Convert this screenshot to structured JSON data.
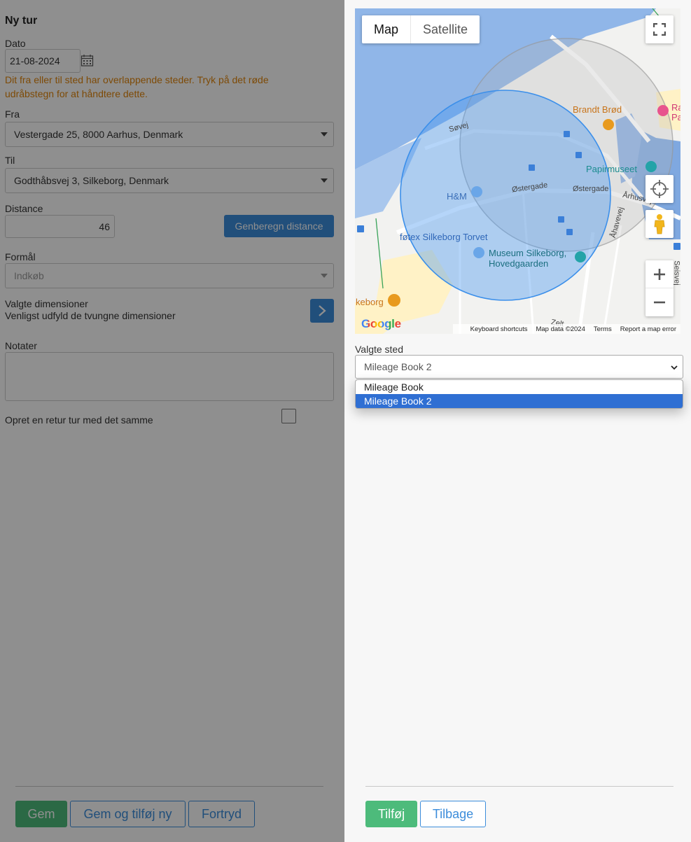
{
  "form": {
    "title": "Ny tur",
    "date_label": "Dato",
    "date_value": "21-08-2024",
    "warning": "Dit fra eller til sted har overlappende steder. Tryk på det røde udråbstegn for at håndtere dette.",
    "from_label": "Fra",
    "from_value": "Vestergade 25, 8000 Aarhus, Denmark",
    "to_label": "Til",
    "to_value": "Godthåbsvej 3, Silkeborg, Denmark",
    "distance_label": "Distance",
    "distance_value": "46",
    "recalc_button": "Genberegn distance",
    "purpose_label": "Formål",
    "purpose_value": "Indkøb",
    "dimensions_title": "Valgte dimensioner",
    "dimensions_hint": "Venligst udfyld de tvungne dimensioner",
    "notes_label": "Notater",
    "return_label": "Opret en retur tur med det samme",
    "save_button": "Gem",
    "save_add_button": "Gem og tilføj ny",
    "cancel_button": "Fortryd"
  },
  "map": {
    "type_map": "Map",
    "type_satellite": "Satellite",
    "labels": {
      "brandt": "Brandt Brød",
      "papir": "Papirmuseet",
      "hm": "H&M",
      "ostergade1": "Østergade",
      "ostergade2": "Østergade",
      "sovej": "Søvej",
      "arhusvej": "Århusvej",
      "ahavevej": "Åhavevej",
      "fotex": "føtex Silkeborg Torvet",
      "museum1": "Museum Silkeborg,",
      "museum2": "Hovedgaarden",
      "keborg": "keborg",
      "seisvej": "Seisvej",
      "zelt": "Zelt",
      "ra": "Ra",
      "pa": "Pa"
    },
    "google": "Google",
    "footer": {
      "shortcuts": "Keyboard shortcuts",
      "data": "Map data ©2024",
      "terms": "Terms",
      "report": "Report a map error"
    }
  },
  "place": {
    "label": "Valgte sted",
    "selected": "Mileage Book 2",
    "options": [
      "Mileage Book",
      "Mileage Book 2"
    ]
  },
  "actions": {
    "add_button": "Tilføj",
    "back_button": "Tilbage"
  },
  "colors": {
    "primary": "#3c8ddb",
    "success": "#4dbb7b",
    "warning": "#e0850b",
    "selected_option": "#2f6fd3"
  }
}
